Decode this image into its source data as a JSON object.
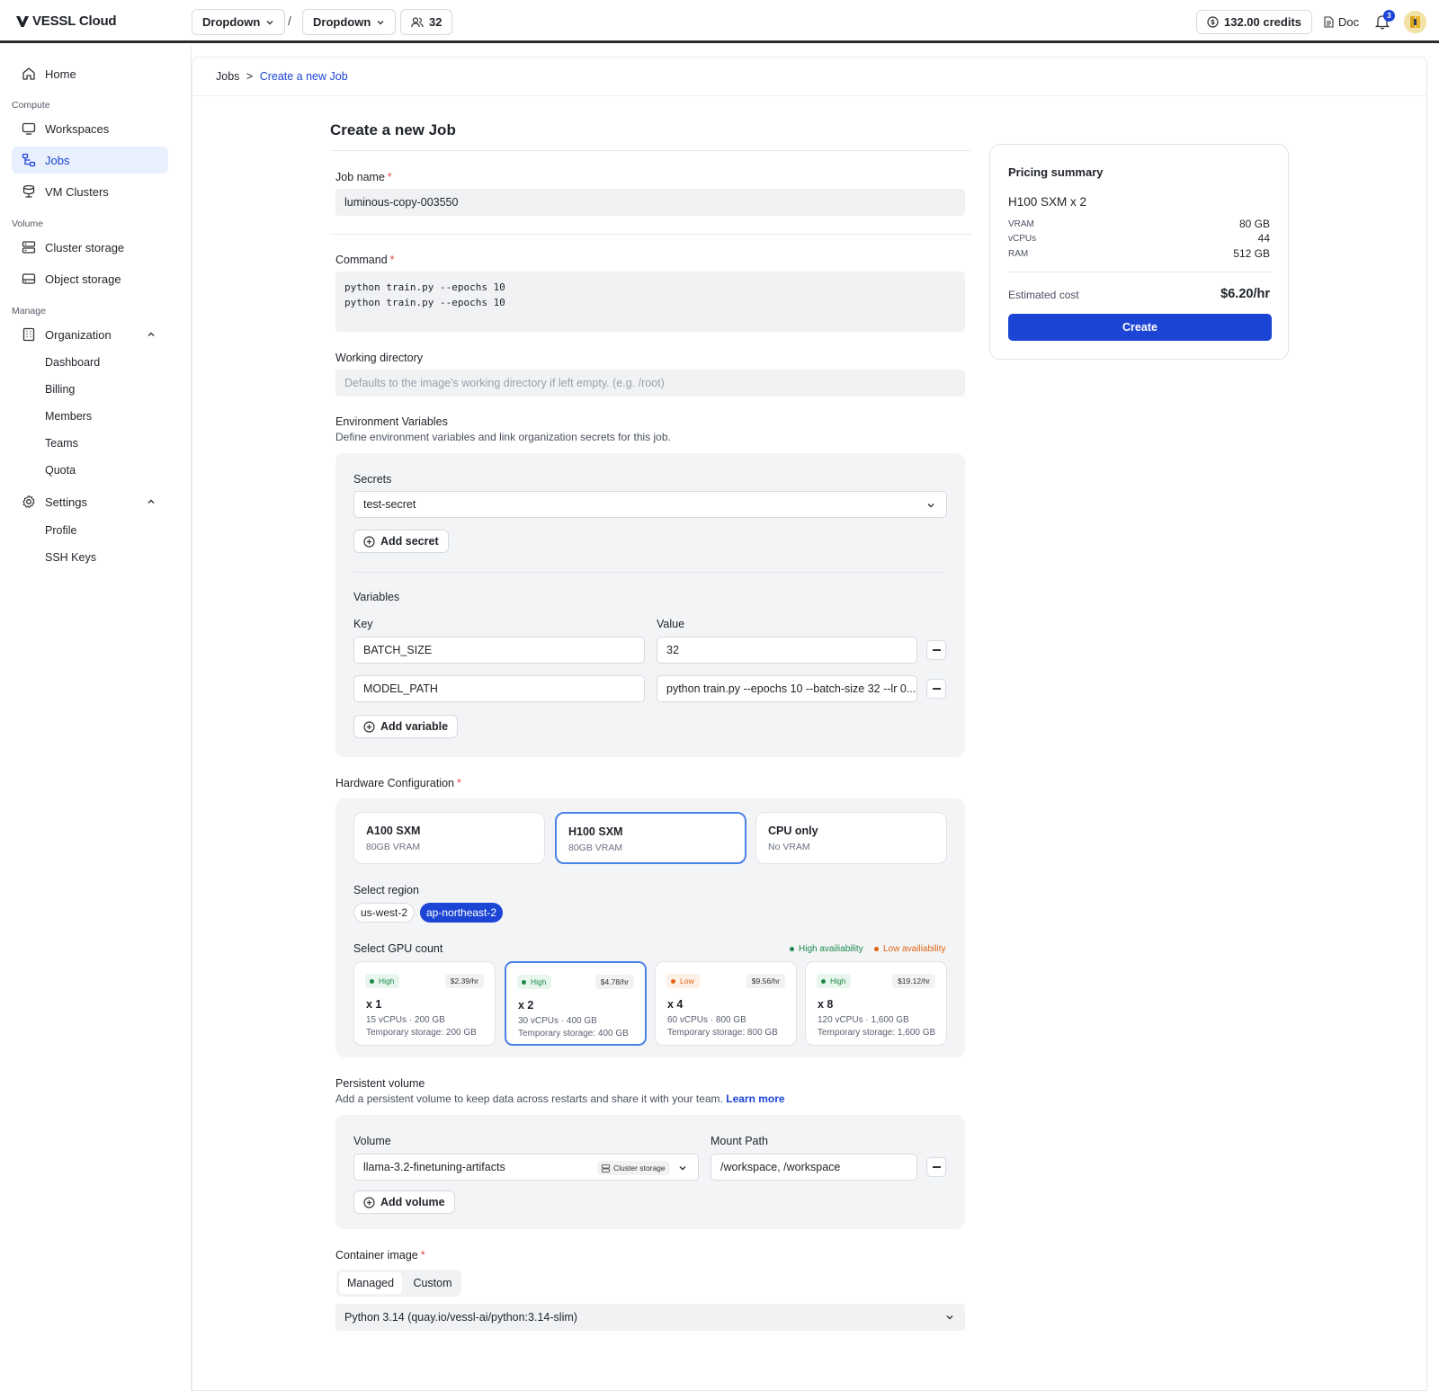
{
  "brand": {
    "name": "VESSL Cloud"
  },
  "topbar": {
    "dropdown1": "Dropdown",
    "dropdown2": "Dropdown",
    "separator": "/",
    "members_count": "32",
    "credits": "132.00 credits",
    "doc": "Doc",
    "notifications": "3"
  },
  "sidebar": {
    "home": "Home",
    "sections": {
      "compute": "Compute",
      "volume": "Volume",
      "manage": "Manage"
    },
    "workspaces": "Workspaces",
    "jobs": "Jobs",
    "vm_clusters": "VM Clusters",
    "cluster_storage": "Cluster storage",
    "object_storage": "Object storage",
    "organization": "Organization",
    "org_items": [
      "Dashboard",
      "Billing",
      "Members",
      "Teams",
      "Quota"
    ],
    "settings": "Settings",
    "settings_items": [
      "Profile",
      "SSH Keys"
    ]
  },
  "breadcrumb": {
    "root": "Jobs",
    "sep": ">",
    "current": "Create a new Job"
  },
  "form": {
    "title": "Create a new Job",
    "job_name": {
      "label": "Job name",
      "value": "luminous-copy-003550"
    },
    "command": {
      "label": "Command",
      "lines": [
        "python train.py --epochs 10",
        "python train.py --epochs 10"
      ]
    },
    "working_dir": {
      "label": "Working directory",
      "placeholder": "Defaults to the image's working directory if left empty. (e.g. /root)"
    },
    "env": {
      "label": "Environment Variables",
      "description": "Define environment variables and link organization secrets for this job.",
      "secrets_label": "Secrets",
      "secret_value": "test-secret",
      "add_secret": "Add secret",
      "variables_label": "Variables",
      "key_label": "Key",
      "value_label": "Value",
      "rows": [
        {
          "key": "BATCH_SIZE",
          "value": "32"
        },
        {
          "key": "MODEL_PATH",
          "value": "python train.py --epochs 10 --batch-size 32 --lr 0..."
        }
      ],
      "add_variable": "Add variable"
    },
    "hardware": {
      "label": "Hardware Configuration",
      "options": [
        {
          "name": "A100 SXM",
          "vram": "80GB VRAM"
        },
        {
          "name": "H100 SXM",
          "vram": "80GB VRAM"
        },
        {
          "name": "CPU only",
          "vram": "No VRAM"
        }
      ],
      "region_label": "Select region",
      "regions": [
        "us-west-2",
        "ap-northeast-2"
      ],
      "gpu_label": "Select GPU count",
      "legend_high": "High availiability",
      "legend_low": "Low availiability",
      "gpu_options": [
        {
          "avail": "High",
          "price": "$2.39/hr",
          "count": "x 1",
          "specs": "15 vCPUs · 200 GB",
          "storage": "Temporary storage: 200 GB"
        },
        {
          "avail": "High",
          "price": "$4.78/hr",
          "count": "x 2",
          "specs": "30 vCPUs · 400 GB",
          "storage": "Temporary storage: 400 GB"
        },
        {
          "avail": "Low",
          "price": "$9.56/hr",
          "count": "x 4",
          "specs": "60 vCPUs · 800 GB",
          "storage": "Temporary storage: 800 GB"
        },
        {
          "avail": "High",
          "price": "$19.12/hr",
          "count": "x 8",
          "specs": "120 vCPUs · 1,600 GB",
          "storage": "Temporary storage: 1,600 GB"
        }
      ]
    },
    "persistent": {
      "label": "Persistent volume",
      "description": "Add a persistent volume to keep data across restarts and share it with your team.",
      "learn_more": "Learn more",
      "volume_label": "Volume",
      "mount_label": "Mount Path",
      "volume_value": "llama-3.2-finetuning-artifacts",
      "volume_type": "Cluster storage",
      "mount_value": "/workspace, /workspace",
      "add_volume": "Add volume"
    },
    "container": {
      "label": "Container image",
      "tabs": [
        "Managed",
        "Custom"
      ],
      "value": "Python 3.14 (quay.io/vessl-ai/python:3.14-slim)"
    }
  },
  "pricing": {
    "title": "Pricing summary",
    "machine": "H100 SXM x 2",
    "specs": [
      {
        "k": "VRAM",
        "v": "80 GB"
      },
      {
        "k": "vCPUs",
        "v": "44"
      },
      {
        "k": "RAM",
        "v": "512 GB"
      }
    ],
    "estimated_label": "Estimated cost",
    "estimated_value": "$6.20/hr",
    "create": "Create"
  },
  "colors": {
    "accent": "#1c45d6",
    "high": "#1c8a4a",
    "low": "#e0650f",
    "required": "#e5484d"
  }
}
